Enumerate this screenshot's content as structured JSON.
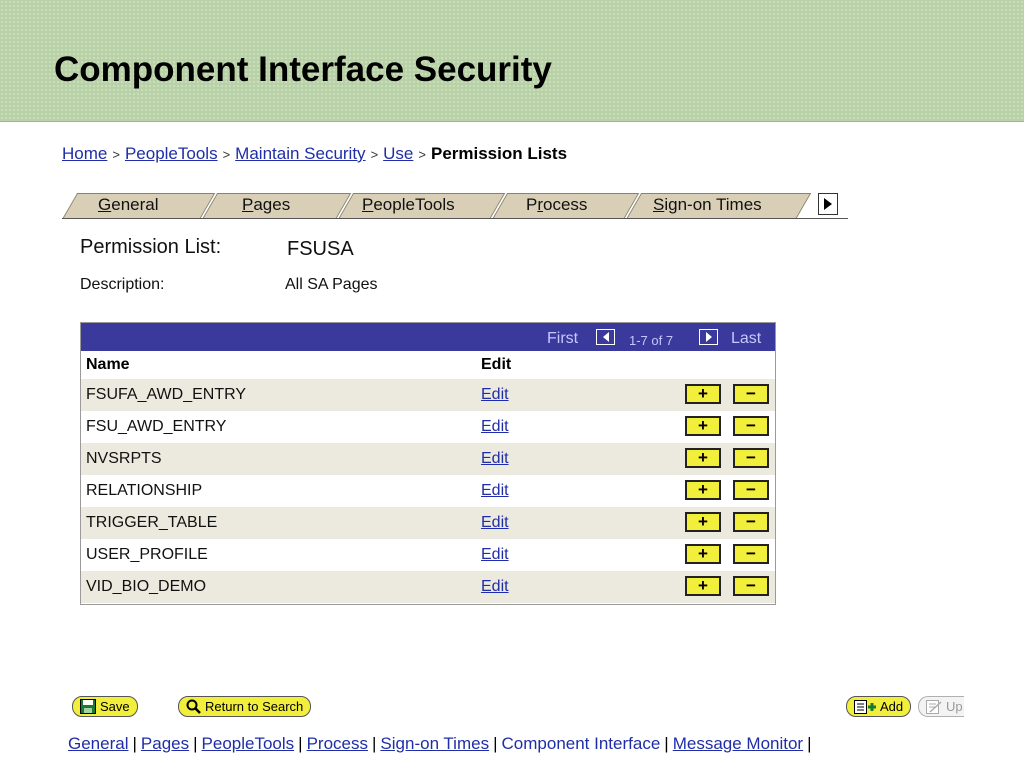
{
  "slide_title": "Component Interface Security",
  "breadcrumb": {
    "items": [
      "Home",
      "PeopleTools",
      "Maintain Security",
      "Use"
    ],
    "separator": ">",
    "current": "Permission Lists"
  },
  "tabs": [
    {
      "pre": "",
      "u": "G",
      "post": "eneral"
    },
    {
      "pre": "",
      "u": "P",
      "post": "ages"
    },
    {
      "pre": "",
      "u": "P",
      "post": "eopleTools"
    },
    {
      "pre": "P",
      "u": "r",
      "post": "ocess"
    },
    {
      "pre": "",
      "u": "S",
      "post": "ign-on Times"
    }
  ],
  "permission_list": {
    "label": "Permission List:",
    "value": "FSUSA"
  },
  "description": {
    "label": "Description:",
    "value": "All SA Pages"
  },
  "grid": {
    "nav_first": "First",
    "nav_count": "1-7 of 7",
    "nav_last": "Last",
    "columns": {
      "name": "Name",
      "edit": "Edit"
    },
    "rows": [
      {
        "name": "FSUFA_AWD_ENTRY",
        "edit": "Edit"
      },
      {
        "name": "FSU_AWD_ENTRY",
        "edit": "Edit"
      },
      {
        "name": "NVSRPTS",
        "edit": "Edit"
      },
      {
        "name": "RELATIONSHIP",
        "edit": "Edit"
      },
      {
        "name": "TRIGGER_TABLE",
        "edit": "Edit"
      },
      {
        "name": "USER_PROFILE",
        "edit": "Edit"
      },
      {
        "name": "VID_BIO_DEMO",
        "edit": "Edit"
      }
    ],
    "add_symbol": "+",
    "delete_symbol": "−"
  },
  "buttons": {
    "save": "Save",
    "return_to_search": "Return to Search",
    "add": "Add",
    "update": "Up"
  },
  "footer_links": [
    {
      "label": "General",
      "link": true
    },
    {
      "label": "Pages",
      "link": true
    },
    {
      "label": "PeopleTools",
      "link": true
    },
    {
      "label": "Process",
      "link": true
    },
    {
      "label": "Sign-on Times",
      "link": true
    },
    {
      "label": "Component Interface",
      "link": false
    },
    {
      "label": "Message Monitor",
      "link": true
    }
  ],
  "colors": {
    "banner": "#b9d1a6",
    "grid_header": "#3a3a9c",
    "link": "#1f2ea8",
    "button_yellow": "#f2ee3c",
    "tab_fill": "#d9cfb7",
    "row_alt": "#eceade"
  }
}
